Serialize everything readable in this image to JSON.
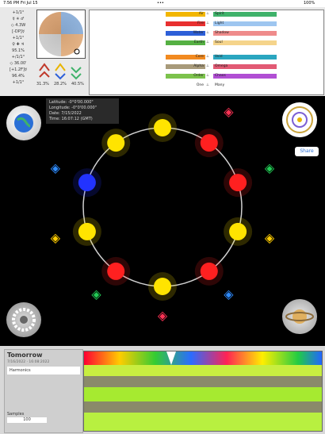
{
  "status": {
    "time": "7:56 PM",
    "date": "Fri Jul 15",
    "dots": "•••",
    "battery": "100%"
  },
  "left_readouts": [
    "+1/1°",
    "◇ 4.3W",
    "[-DP]☿",
    "+1/1°",
    "95.1%",
    "+/1/1°",
    "◇ 36.00'",
    "[+1.2F]☿",
    "96.4%",
    "+1/1°"
  ],
  "percents": [
    "31.3%",
    "28.2%",
    "40.5%"
  ],
  "table_rows": [
    {
      "left": "Air",
      "right": "Spirit",
      "lcolor": "#f2b600",
      "rcolor": "#3fb26a"
    },
    {
      "left": "Fire",
      "right": "Light",
      "lcolor": "#e83030",
      "rcolor": "#9ec6f0"
    },
    {
      "left": "Water",
      "right": "Shadow",
      "lcolor": "#2d5fd8",
      "rcolor": "#ef8b8b"
    },
    {
      "left": "Earth",
      "right": "Soul",
      "lcolor": "#55b043",
      "rcolor": "#f5d48b"
    },
    {
      "left": "Core",
      "right": "Void",
      "lcolor": "#f28a20",
      "rcolor": "#2aa6c0"
    },
    {
      "left": "Alpha",
      "right": "Omega",
      "lcolor": "#a89a7a",
      "rcolor": "#e25a74"
    },
    {
      "left": "Order",
      "right": "Chaos",
      "lcolor": "#7cc24c",
      "rcolor": "#b14fd4"
    },
    {
      "left": "One",
      "right": "Many",
      "lcolor": "#ffffff",
      "rcolor": "#ffffff"
    }
  ],
  "info": {
    "lat": "Latitude: -0°0'00.000\"",
    "lon": "Longitude: -0°0'00.000\"",
    "date": "Date: 7/15/2022",
    "time": "Time: 16:07:12 (GMT)"
  },
  "share_label": "Share",
  "bottom": {
    "title": "Tomorrow",
    "subtitle": "7/16/2022 · 16:08:2022",
    "list_item": "Harmonics",
    "samples_label": "Samples",
    "samples_value": "100"
  }
}
